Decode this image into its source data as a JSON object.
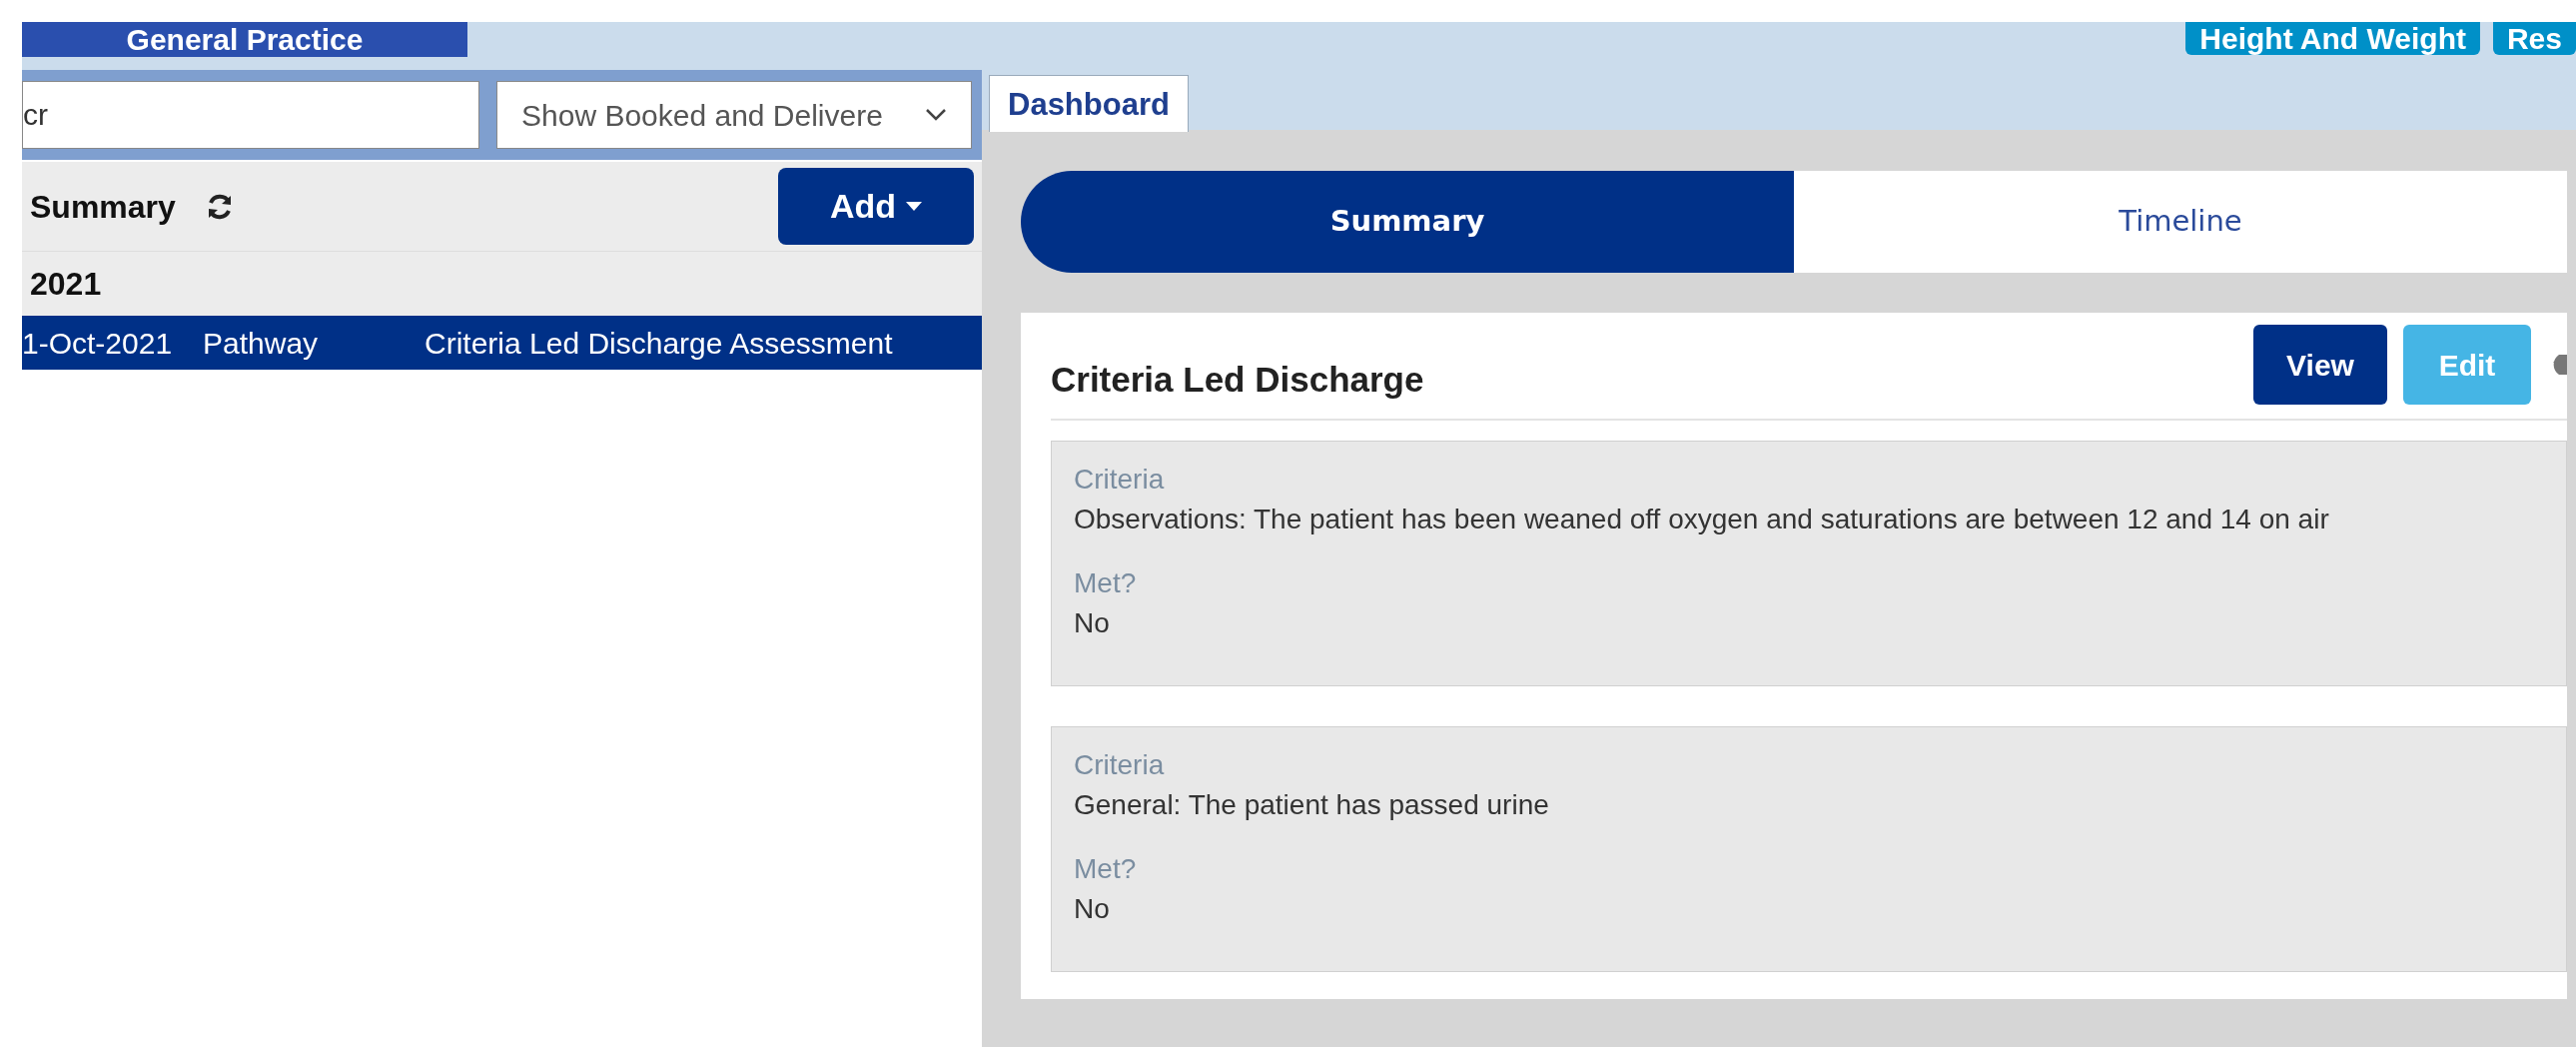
{
  "header": {
    "practice_tab": "General Practice",
    "buttons": [
      {
        "label": "Height And Weight"
      },
      {
        "label": "Res"
      }
    ]
  },
  "filters": {
    "search": {
      "value": "cr"
    },
    "select": {
      "value": "Show Booked and Delivere"
    }
  },
  "list": {
    "title": "Summary",
    "add_button": "Add",
    "groups": [
      {
        "year": "2021",
        "rows": [
          {
            "date": "1-Oct-2021",
            "type": "Pathway",
            "description": "Criteria Led Discharge Assessment",
            "selected": true
          }
        ]
      }
    ]
  },
  "tabs": [
    {
      "label": "Dashboard",
      "selected": true
    }
  ],
  "view_switch": [
    {
      "label": "Summary",
      "selected": true
    },
    {
      "label": "Timeline",
      "selected": false
    }
  ],
  "card": {
    "title": "Criteria Led Discharge",
    "actions": [
      {
        "label": "View",
        "kind": "primary"
      },
      {
        "label": "Edit",
        "kind": "secondary"
      }
    ],
    "criteria": [
      {
        "criteria_label": "Criteria",
        "criteria": "Observations: The patient has been weaned off oxygen and saturations are between 12 and 14 on air",
        "met_label": "Met?",
        "met": "No"
      },
      {
        "criteria_label": "Criteria",
        "criteria": "General: The patient has passed urine",
        "met_label": "Met?",
        "met": "No"
      }
    ]
  }
}
